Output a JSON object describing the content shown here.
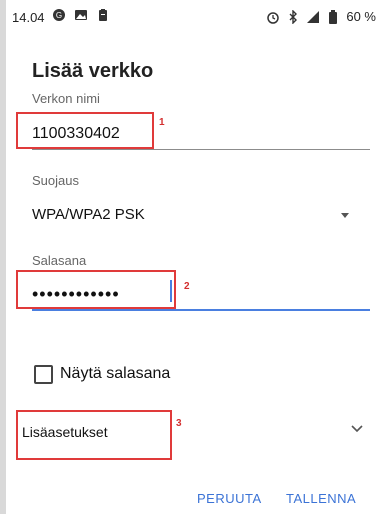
{
  "status_bar": {
    "time": "14.04",
    "battery": "60 %",
    "icons": [
      "app-icon",
      "image-icon",
      "clipboard-icon",
      "alarm-icon",
      "bluetooth-icon",
      "signal-icon",
      "battery-icon"
    ]
  },
  "dialog": {
    "title": "Lisää verkko",
    "network_name": {
      "label": "Verkon nimi",
      "value": "1100330402"
    },
    "security": {
      "label": "Suojaus",
      "value": "WPA/WPA2 PSK"
    },
    "password": {
      "label": "Salasana",
      "value": "••••••••••••"
    },
    "show_password_label": "Näytä salasana",
    "advanced_label": "Lisäasetukset",
    "cancel_label": "PERUUTA",
    "save_label": "TALLENNA"
  },
  "annotations": [
    "1",
    "2",
    "3"
  ],
  "colors": {
    "accent": "#3b73d6",
    "highlight": "#e03a3a"
  }
}
